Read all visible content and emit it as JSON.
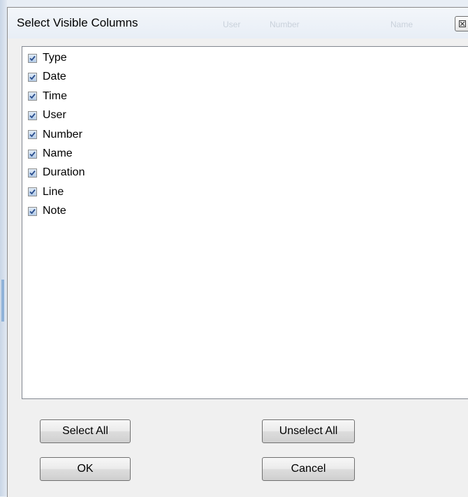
{
  "dialog": {
    "title": "Select Visible Columns",
    "ghost_headers": [
      "User",
      "Number",
      "Name"
    ]
  },
  "columns": [
    {
      "label": "Type",
      "checked": true
    },
    {
      "label": "Date",
      "checked": true
    },
    {
      "label": "Time",
      "checked": true
    },
    {
      "label": "User",
      "checked": true
    },
    {
      "label": "Number",
      "checked": true
    },
    {
      "label": "Name",
      "checked": true
    },
    {
      "label": "Duration",
      "checked": true
    },
    {
      "label": "Line",
      "checked": true
    },
    {
      "label": "Note",
      "checked": true
    }
  ],
  "buttons": {
    "select_all": "Select All",
    "unselect_all": "Unselect All",
    "ok": "OK",
    "cancel": "Cancel"
  },
  "icons": {
    "close": "close-icon",
    "check": "checkmark-icon"
  },
  "colors": {
    "check": "#2a4f8f",
    "listbox_border": "#828790",
    "dialog_bg": "#f0f0f0"
  }
}
